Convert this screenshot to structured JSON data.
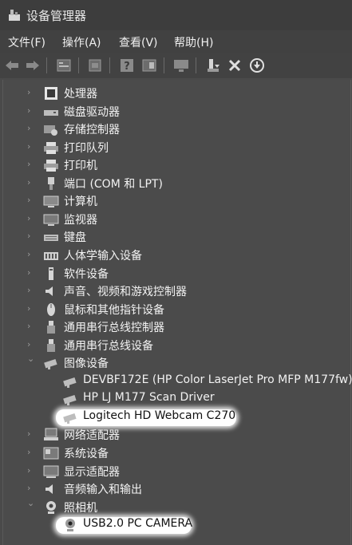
{
  "window": {
    "title": "设备管理器",
    "app_icon": "device-manager-icon"
  },
  "menu": [
    "文件(F)",
    "操作(A)",
    "查看(V)",
    "帮助(H)"
  ],
  "toolbar": {
    "buttons": [
      "back-icon",
      "forward-icon",
      "properties-icon",
      "update-list-icon",
      "help-icon",
      "show-hidden-icon",
      "monitor-icon",
      "update-driver-icon",
      "uninstall-icon",
      "scan-icon"
    ]
  },
  "tree": [
    {
      "label": "处理器",
      "icon": "processor-icon"
    },
    {
      "label": "磁盘驱动器",
      "icon": "disk-icon"
    },
    {
      "label": "存储控制器",
      "icon": "storage-controller-icon"
    },
    {
      "label": "打印队列",
      "icon": "printer-icon"
    },
    {
      "label": "打印机",
      "icon": "printer-icon"
    },
    {
      "label": "端口 (COM 和 LPT)",
      "icon": "port-icon"
    },
    {
      "label": "计算机",
      "icon": "computer-icon"
    },
    {
      "label": "监视器",
      "icon": "monitor-icon"
    },
    {
      "label": "键盘",
      "icon": "keyboard-icon"
    },
    {
      "label": "人体学输入设备",
      "icon": "hid-icon"
    },
    {
      "label": "软件设备",
      "icon": "software-device-icon"
    },
    {
      "label": "声音、视频和游戏控制器",
      "icon": "sound-icon"
    },
    {
      "label": "鼠标和其他指针设备",
      "icon": "mouse-icon"
    },
    {
      "label": "通用串行总线控制器",
      "icon": "usb-icon"
    },
    {
      "label": "通用串行总线设备",
      "icon": "usb-icon"
    },
    {
      "label": "图像设备",
      "icon": "imaging-device-icon",
      "expanded": true,
      "children": [
        {
          "label": "DEVBF172E (HP Color LaserJet Pro MFP M177fw)",
          "icon": "scanner-icon"
        },
        {
          "label": "HP LJ M177 Scan Driver",
          "icon": "scanner-icon"
        },
        {
          "label": "Logitech HD Webcam C270",
          "icon": "scanner-icon",
          "highlighted": true
        }
      ]
    },
    {
      "label": "网络适配器",
      "icon": "network-adapter-icon"
    },
    {
      "label": "系统设备",
      "icon": "system-device-icon"
    },
    {
      "label": "显示适配器",
      "icon": "display-adapter-icon"
    },
    {
      "label": "音频输入和输出",
      "icon": "audio-io-icon"
    },
    {
      "label": "照相机",
      "icon": "camera-icon",
      "expanded": true,
      "children": [
        {
          "label": "USB2.0 PC CAMERA",
          "icon": "webcam-icon",
          "highlighted": true
        }
      ]
    }
  ]
}
